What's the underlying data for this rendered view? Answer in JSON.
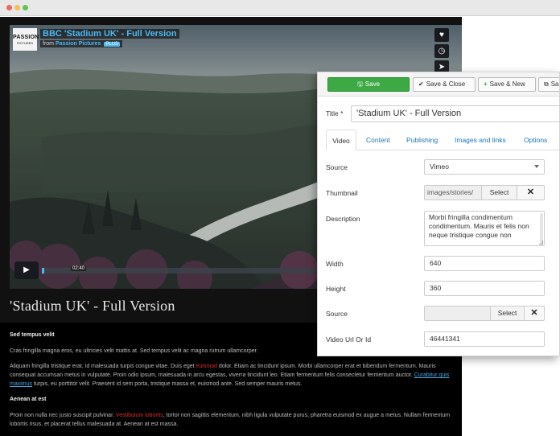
{
  "video": {
    "logo_line1": "PASSION",
    "logo_line2": "PICTURES",
    "title": "BBC 'Stadium UK' - Full Version",
    "from_label": "from",
    "from_by": "Passion Pictures",
    "plus_badge": "PLUS",
    "timecode": "02:40",
    "progress_fraction": 0.01,
    "side_icons": [
      "heart-icon",
      "clock-icon",
      "send-icon"
    ]
  },
  "site": {
    "title": "'Stadium UK' - Full Version",
    "heading1": "Sed tempus velit",
    "para1": "Cras fringilla magna eros, eu ultricies velit mattis at. Sed tempus velit ac magna rutrum ullamcorper.",
    "para2_a": "Aliquam fringilla tristique erat, id malesuada turpis congue vitae. Duis eget ",
    "para2_red": "euismod",
    "para2_b": " dolor. Etiam ac tincidunt ipsum. Morbi ullamcorper erat et bibendum fermentum. Mauris consequat accumsan metus in vulputate. Proin odio ipsum, malesuada in arcu egestas, viverra tincidunt leo. Etiam fermentum felis consectetur fermentum auctor. ",
    "para2_link": "Curabitur quis maximus",
    "para2_c": " turpis, eu porttitor velit. Praesent id sem porta, tristique massa et, euismod ante. Sed semper mauris metus.",
    "heading2": "Aenean at est",
    "para3_a": "Proin non nulla nec justo suscipit pulvinar. ",
    "para3_red": "Vestibulum lobortis",
    "para3_b": ", tortor non sagittis elementum, nibh ligula vulputate purus, pharetra euismod ex augue a metus. Nullam fermentum lobortis risus, et placerat tellus malesuada at. Aenean at est massa."
  },
  "toolbar": {
    "save_label": "Save",
    "save_close_label": "Save & Close",
    "save_new_label": "Save & New",
    "save_as_label": "Sa"
  },
  "form": {
    "title_label": "Title",
    "title_required": "*",
    "title_value": "'Stadium UK' - Full Version",
    "tabs": [
      "Video",
      "Content",
      "Publishing",
      "Images and links",
      "Options"
    ],
    "source_label": "Source",
    "source_value": "Vimeo",
    "thumbnail_label": "Thumbnail",
    "thumbnail_value": "images/stories/",
    "select_label": "Select",
    "clear_label": "✕",
    "description_label": "Description",
    "description_value": "Morbi fringilla condimentum condimentum. Mauris et felis non neque tristique congue non",
    "width_label": "Width",
    "width_value": "640",
    "height_label": "Height",
    "height_value": "360",
    "source2_label": "Source",
    "source2_value": "",
    "url_label": "Video Url Or Id",
    "url_value": "46441341"
  },
  "colors": {
    "accent_blue": "#4fb8f2",
    "save_green": "#3da944",
    "link_blue": "#1f77b4",
    "highlight_red": "#e02b2b"
  }
}
